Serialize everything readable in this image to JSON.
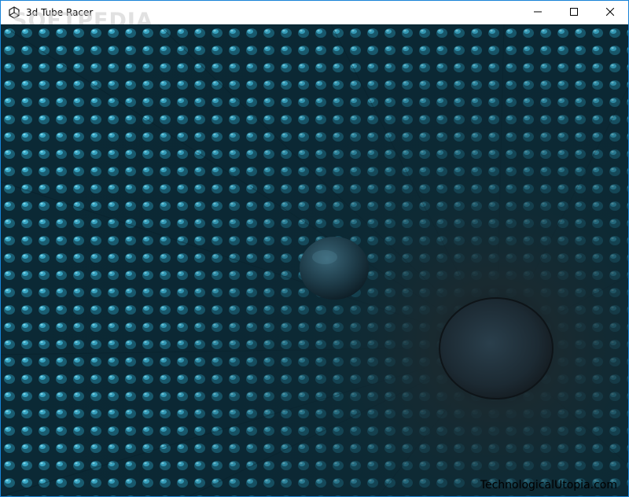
{
  "window": {
    "title": "3d Tube Racer",
    "watermark": "SOFTPEDIA",
    "icon": "unity-logo-icon",
    "controls": {
      "minimize": "minimize-icon",
      "maximize": "maximize-icon",
      "close": "close-icon"
    }
  },
  "game": {
    "credit": "TechnologicalUtopia.com",
    "colors": {
      "tube_dark": "#0a2530",
      "tube_glow": "#3fb8d8",
      "tunnel_end": "#161c22",
      "ball": "#1f3b4a"
    }
  }
}
